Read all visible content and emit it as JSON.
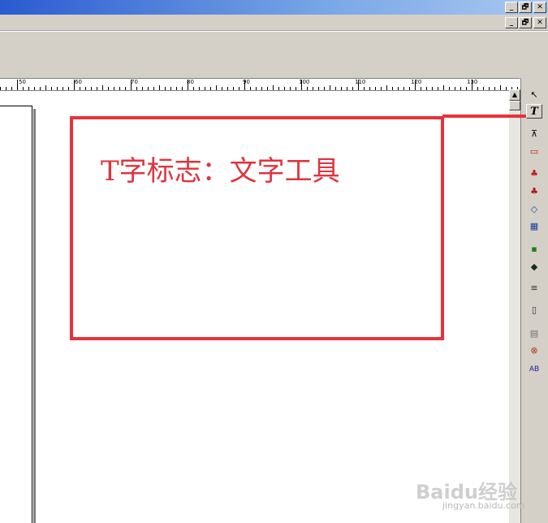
{
  "window": {
    "controls": [
      "_",
      "🗗",
      "✕"
    ],
    "doc_controls": [
      "_",
      "🗗",
      "✕"
    ]
  },
  "ruler": {
    "labels": [
      "50",
      "60",
      "70",
      "80",
      "90",
      "100",
      "110",
      "120",
      "130",
      "1"
    ]
  },
  "annotation": {
    "caption": "T字标志：文字工具"
  },
  "tools": [
    {
      "name": "pointer-tool-icon",
      "glyph": "↖"
    },
    {
      "name": "text-tool-icon",
      "glyph": "T"
    },
    {
      "name": "crop-tool-icon",
      "glyph": "⊼"
    },
    {
      "name": "frame-tool-icon",
      "glyph": "▭"
    },
    {
      "name": "fruit-tool-icon-1",
      "glyph": "♣"
    },
    {
      "name": "fruit-tool-icon-2",
      "glyph": "♣"
    },
    {
      "name": "shapes-tool-icon",
      "glyph": "◇"
    },
    {
      "name": "table-tool-icon",
      "glyph": "▦"
    },
    {
      "name": "color-grid-icon",
      "glyph": "▪"
    },
    {
      "name": "fill-tool-icon",
      "glyph": "◆"
    },
    {
      "name": "paragraph-tool-icon",
      "glyph": "≡"
    },
    {
      "name": "page-tool-icon",
      "glyph": "▯"
    },
    {
      "name": "layer-tool-icon",
      "glyph": "▤"
    },
    {
      "name": "link-tool-icon",
      "glyph": "⊗"
    },
    {
      "name": "ab-tool-icon",
      "glyph": "AB"
    }
  ],
  "watermark": {
    "brand": "Baidu经验",
    "url": "jingyan.baidu.com"
  },
  "colors": {
    "highlight": "#e8323a",
    "caption": "#e0343c",
    "titlebar": "#2a5bd0",
    "chrome": "#d4d0c8"
  }
}
